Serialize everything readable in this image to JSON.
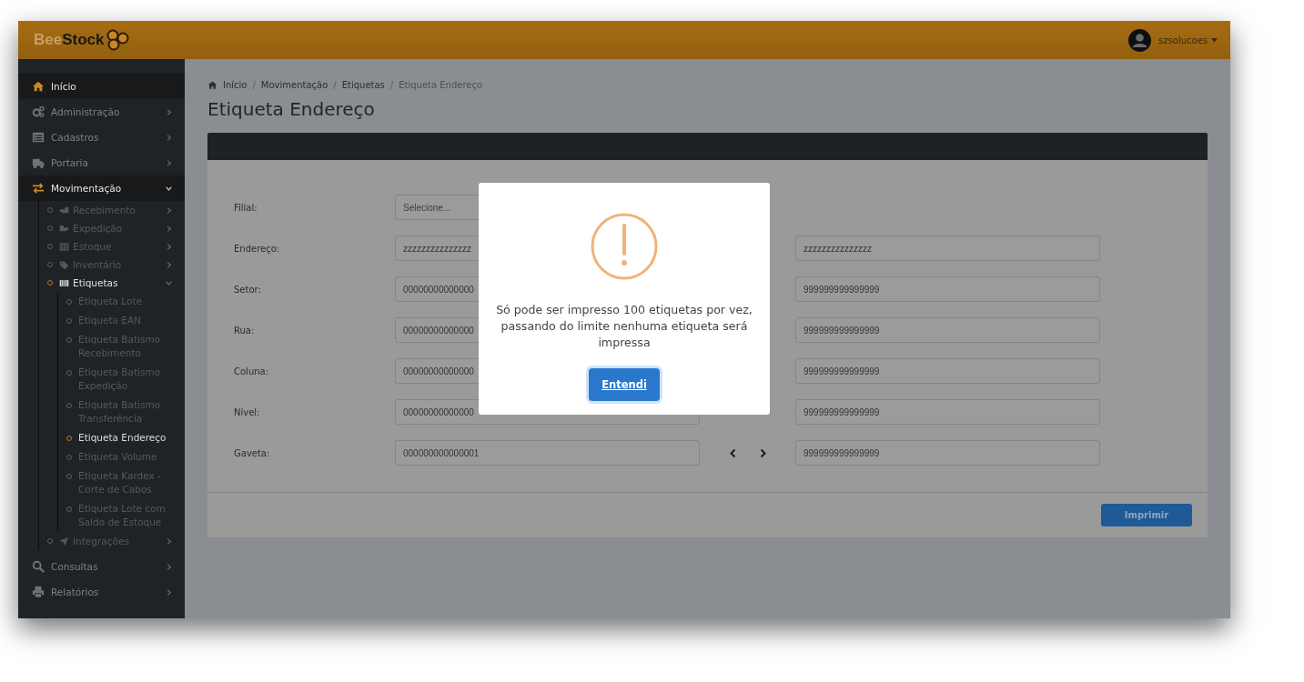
{
  "header": {
    "logo": {
      "first": "Bee",
      "second": "Stock"
    },
    "user": "szsolucoes"
  },
  "sidebar": {
    "items": [
      {
        "label": "Início",
        "selected": true
      },
      {
        "label": "Administração",
        "selected": false,
        "expanded": false
      },
      {
        "label": "Cadastros",
        "selected": false,
        "expanded": false
      },
      {
        "label": "Portaria",
        "selected": false,
        "expanded": false
      },
      {
        "label": "Movimentação",
        "selected": true,
        "expanded": true,
        "children": [
          {
            "label": "Recebimento",
            "selected": false,
            "expanded": false
          },
          {
            "label": "Expedição",
            "selected": false,
            "expanded": false
          },
          {
            "label": "Estoque",
            "selected": false,
            "expanded": false
          },
          {
            "label": "Inventário",
            "selected": false,
            "expanded": false
          },
          {
            "label": "Etiquetas",
            "selected": true,
            "expanded": true,
            "children": [
              {
                "label": "Etiqueta Lote",
                "selected": false
              },
              {
                "label": "Etiqueta EAN",
                "selected": false
              },
              {
                "label": "Etiqueta Batismo Recebimento",
                "selected": false
              },
              {
                "label": "Etiqueta Batismo Expedição",
                "selected": false
              },
              {
                "label": "Etiqueta Batismo Transferência",
                "selected": false
              },
              {
                "label": "Etiqueta Endereço",
                "selected": true
              },
              {
                "label": "Etiqueta Volume",
                "selected": false
              },
              {
                "label": "Etiqueta Kardex - Corte de Cabos",
                "selected": false
              },
              {
                "label": "Etiqueta Lote com Saldo de Estoque",
                "selected": false
              }
            ]
          },
          {
            "label": "Integrações",
            "selected": false,
            "expanded": false
          }
        ]
      },
      {
        "label": "Consultas",
        "selected": false,
        "expanded": false
      },
      {
        "label": "Relatórios",
        "selected": false,
        "expanded": false
      }
    ]
  },
  "breadcrumb": {
    "separator": "/",
    "items": [
      "Início",
      "Movimentação",
      "Etiquetas",
      "Etiqueta Endereço"
    ]
  },
  "title": "Etiqueta Endereço",
  "form": {
    "rows": [
      {
        "label": "Filial:",
        "kind": "select",
        "placeholder": "Selecione..."
      },
      {
        "label": "Endereço:",
        "kind": "range",
        "from": "zzzzzzzzzzzzzzz",
        "to": "zzzzzzzzzzzzzzz"
      },
      {
        "label": "Setor:",
        "kind": "range",
        "from": "00000000000000",
        "to": "999999999999999"
      },
      {
        "label": "Rua:",
        "kind": "range",
        "from": "00000000000000",
        "to": "999999999999999"
      },
      {
        "label": "Coluna:",
        "kind": "range",
        "from": "00000000000000",
        "to": "999999999999999"
      },
      {
        "label": "Nível:",
        "kind": "range",
        "from": "00000000000000",
        "to": "999999999999999"
      },
      {
        "label": "Gaveta:",
        "kind": "range",
        "from": "000000000000001",
        "to": "999999999999999",
        "nav_arrows": true
      }
    ],
    "submit": "Imprimir"
  },
  "modal": {
    "message": "Só pode ser impresso 100 etiquetas por vez, passando do limite nenhuma etiqueta será impressa",
    "button": "Entendi"
  }
}
